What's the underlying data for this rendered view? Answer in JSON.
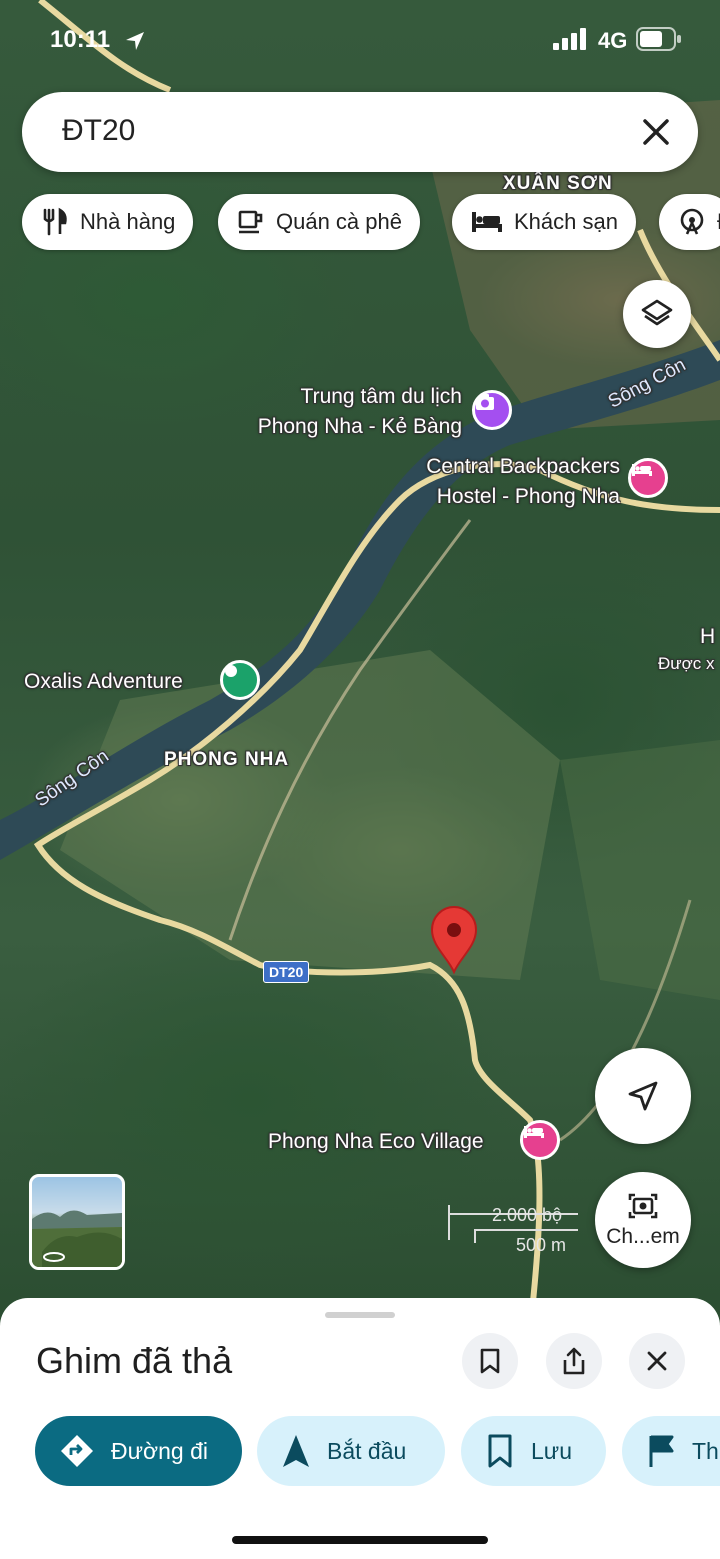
{
  "status_bar": {
    "time": "10:11",
    "network": "4G"
  },
  "search": {
    "query": "ĐT20"
  },
  "chips": [
    {
      "label": "Nhà hàng",
      "icon": "restaurant-icon"
    },
    {
      "label": "Quán cà phê",
      "icon": "coffee-icon"
    },
    {
      "label": "Khách sạn",
      "icon": "hotel-icon"
    },
    {
      "label": "Đ",
      "icon": "attraction-icon"
    }
  ],
  "map": {
    "labels": {
      "xuan_son": "XUÂN SƠN",
      "song_con_top": "Sông Côn",
      "song_con_left": "Sông Côn",
      "phong_nha": "PHONG NHA",
      "h_edge": "H",
      "duoc_x": "Được x",
      "d_edge": "D"
    },
    "pois": [
      {
        "name": "Trung tâm du lịch\nPhong Nha - Kẻ Bàng",
        "line1": "Trung tâm du lịch",
        "line2": "Phong Nha - Kẻ Bàng",
        "type": "camera-icon",
        "color": "#a44ff0"
      },
      {
        "name": "Central Backpackers Hostel - Phong Nha",
        "line1": "Central Backpackers",
        "line2": "Hostel - Phong Nha",
        "type": "hotel-icon",
        "color": "#e6408f"
      },
      {
        "name": "Oxalis Adventure",
        "line1": "Oxalis Adventure",
        "type": "green-pin-icon",
        "color": "#1ba26a"
      },
      {
        "name": "Phong Nha Eco Village",
        "line1": "Phong Nha Eco Village",
        "type": "hotel-icon",
        "color": "#e6408f"
      }
    ],
    "road_shield": "DT20",
    "scale": {
      "imperial": "2.000 bộ",
      "metric": "500 m"
    },
    "fab_label": "Ch...em"
  },
  "sheet": {
    "title": "Ghim đã thả",
    "actions": [
      {
        "label": "Đường đi",
        "icon": "directions-icon",
        "style": "primary"
      },
      {
        "label": "Bắt đầu",
        "icon": "navigation-arrow-icon",
        "style": "secondary"
      },
      {
        "label": "Lưu",
        "icon": "bookmark-icon",
        "style": "secondary"
      },
      {
        "label": "Th",
        "icon": "flag-icon",
        "style": "secondary"
      }
    ]
  },
  "colors": {
    "primary": "#0b6b82",
    "secondary_bg": "#d7f1fb",
    "pin": "#e53935"
  }
}
